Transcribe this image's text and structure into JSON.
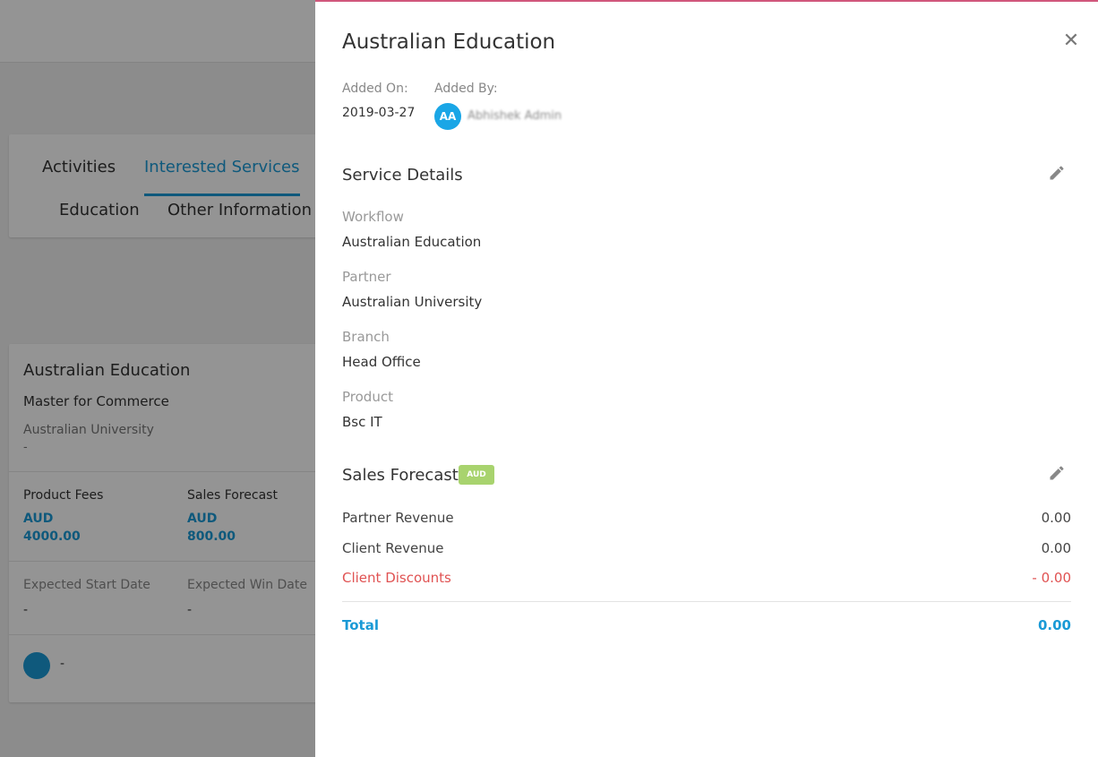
{
  "background": {
    "tabs": [
      "Activities",
      "Interested Services",
      "Education",
      "Other Information"
    ],
    "service_card": {
      "title": "Australian Education",
      "subtitle": "Master for Commerce",
      "partner": "Australian University",
      "partner_dash": "-",
      "product_fees_label": "Product Fees",
      "product_fees_currency": "AUD",
      "product_fees_value": "4000.00",
      "sales_forecast_label": "Sales Forecast",
      "sales_forecast_currency": "AUD",
      "sales_forecast_value": "800.00",
      "expected_start_label": "Expected Start Date",
      "expected_start_value": "-",
      "expected_win_label": "Expected Win Date",
      "expected_win_value": "-",
      "assignee_value": "-"
    }
  },
  "drawer": {
    "title": "Australian Education",
    "close_icon": "close-icon",
    "added_on_label": "Added On:",
    "added_on_value": "2019-03-27",
    "added_by_label": "Added By:",
    "added_by_initials": "AA",
    "added_by_name": "Abhishek Admin",
    "service_details": {
      "title": "Service Details",
      "workflow_label": "Workflow",
      "workflow_value": "Australian Education",
      "partner_label": "Partner",
      "partner_value": "Australian University",
      "branch_label": "Branch",
      "branch_value": "Head Office",
      "product_label": "Product",
      "product_value": "Bsc IT"
    },
    "sales_forecast": {
      "title": "Sales Forecast",
      "currency_badge": "AUD",
      "partner_revenue_label": "Partner Revenue",
      "partner_revenue_value": "0.00",
      "client_revenue_label": "Client Revenue",
      "client_revenue_value": "0.00",
      "client_discounts_label": "Client Discounts",
      "client_discounts_value": "- 0.00",
      "total_label": "Total",
      "total_value": "0.00"
    },
    "colors": {
      "accent": "#1a9ad6",
      "discount": "#e05252",
      "badge": "#a8d36e",
      "top_border": "#d0577c"
    }
  }
}
